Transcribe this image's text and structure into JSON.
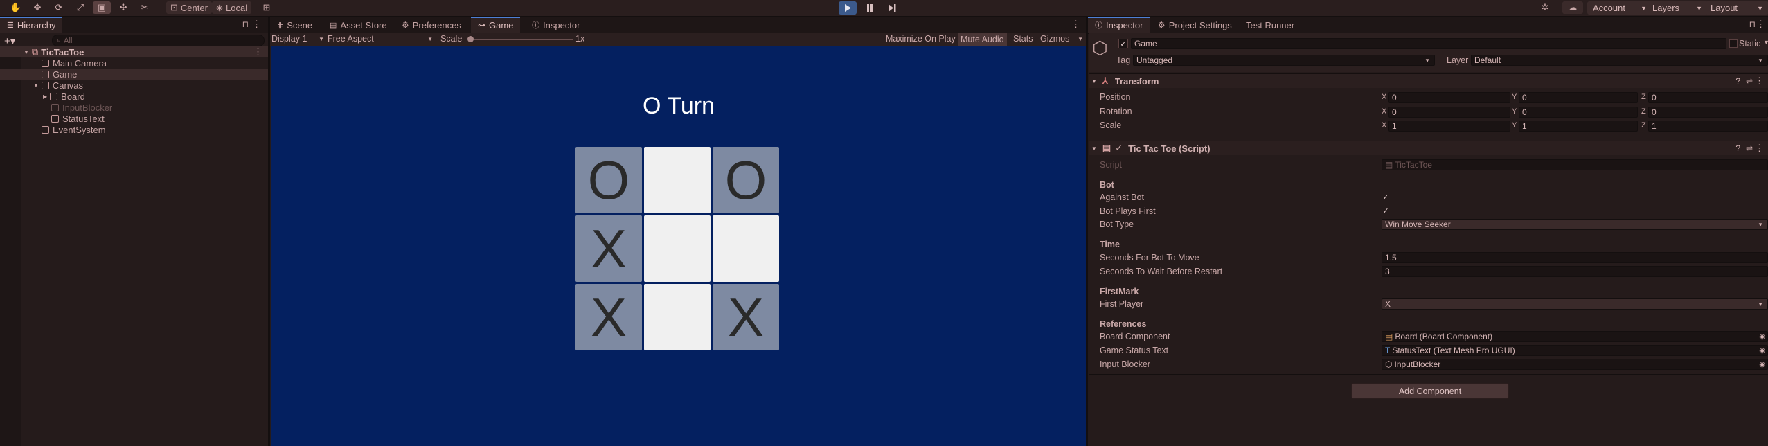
{
  "toolbar": {
    "tools": [
      "hand-tool",
      "move-tool",
      "rotate-tool",
      "scale-tool",
      "rect-tool",
      "transform-tool",
      "custom-tool"
    ],
    "pivot_label": "Center",
    "space_label": "Local",
    "account_label": "Account",
    "layers_label": "Layers",
    "layout_label": "Layout"
  },
  "hierarchy": {
    "tab_label": "Hierarchy",
    "search_placeholder": "All",
    "scene_name": "TicTacToe",
    "items": [
      {
        "label": "Main Camera"
      },
      {
        "label": "Game"
      },
      {
        "label": "Canvas"
      },
      {
        "label": "Board"
      },
      {
        "label": "InputBlocker"
      },
      {
        "label": "StatusText"
      },
      {
        "label": "EventSystem"
      }
    ]
  },
  "center_tabs": [
    {
      "label": "Scene"
    },
    {
      "label": "Asset Store"
    },
    {
      "label": "Preferences"
    },
    {
      "label": "Game"
    },
    {
      "label": "Inspector"
    }
  ],
  "game_toolbar": {
    "display": "Display 1",
    "aspect": "Free Aspect",
    "scale_label": "Scale",
    "scale_value": "1x",
    "maximize": "Maximize On Play",
    "mute": "Mute Audio",
    "stats": "Stats",
    "gizmos": "Gizmos"
  },
  "game": {
    "status": "O Turn",
    "board": [
      "O",
      "",
      "O",
      "X",
      "",
      "",
      "X",
      "",
      "X"
    ]
  },
  "inspector_tabs": [
    {
      "label": "Inspector"
    },
    {
      "label": "Project Settings"
    },
    {
      "label": "Test Runner"
    }
  ],
  "inspector": {
    "object_name": "Game",
    "static_label": "Static",
    "tag_label": "Tag",
    "tag_value": "Untagged",
    "layer_label": "Layer",
    "layer_value": "Default",
    "transform": {
      "title": "Transform",
      "rows": [
        {
          "label": "Position",
          "x": "0",
          "y": "0",
          "z": "0"
        },
        {
          "label": "Rotation",
          "x": "0",
          "y": "0",
          "z": "0"
        },
        {
          "label": "Scale",
          "x": "1",
          "y": "1",
          "z": "1"
        }
      ]
    },
    "script": {
      "title": "Tic Tac Toe (Script)",
      "script_label": "Script",
      "script_value": "TicTacToe",
      "bot_header": "Bot",
      "against_bot": "Against Bot",
      "bot_plays_first": "Bot Plays First",
      "bot_type_label": "Bot Type",
      "bot_type_value": "Win Move Seeker",
      "time_header": "Time",
      "seconds_bot_label": "Seconds For Bot To Move",
      "seconds_bot_value": "1.5",
      "seconds_restart_label": "Seconds To Wait Before Restart",
      "seconds_restart_value": "3",
      "firstmark_header": "FirstMark",
      "first_player_label": "First Player",
      "first_player_value": "X",
      "references_header": "References",
      "board_component_label": "Board Component",
      "board_component_value": "Board (Board Component)",
      "game_status_label": "Game Status Text",
      "game_status_value": "StatusText (Text Mesh Pro UGUI)",
      "input_blocker_label": "Input Blocker",
      "input_blocker_value": "InputBlocker"
    },
    "add_component": "Add Component"
  },
  "colors": {
    "game_bg": "#042060",
    "cell_dark": "#7e8aa2",
    "cell_light": "#f0f0f0",
    "accent": "#4d7fd6"
  }
}
